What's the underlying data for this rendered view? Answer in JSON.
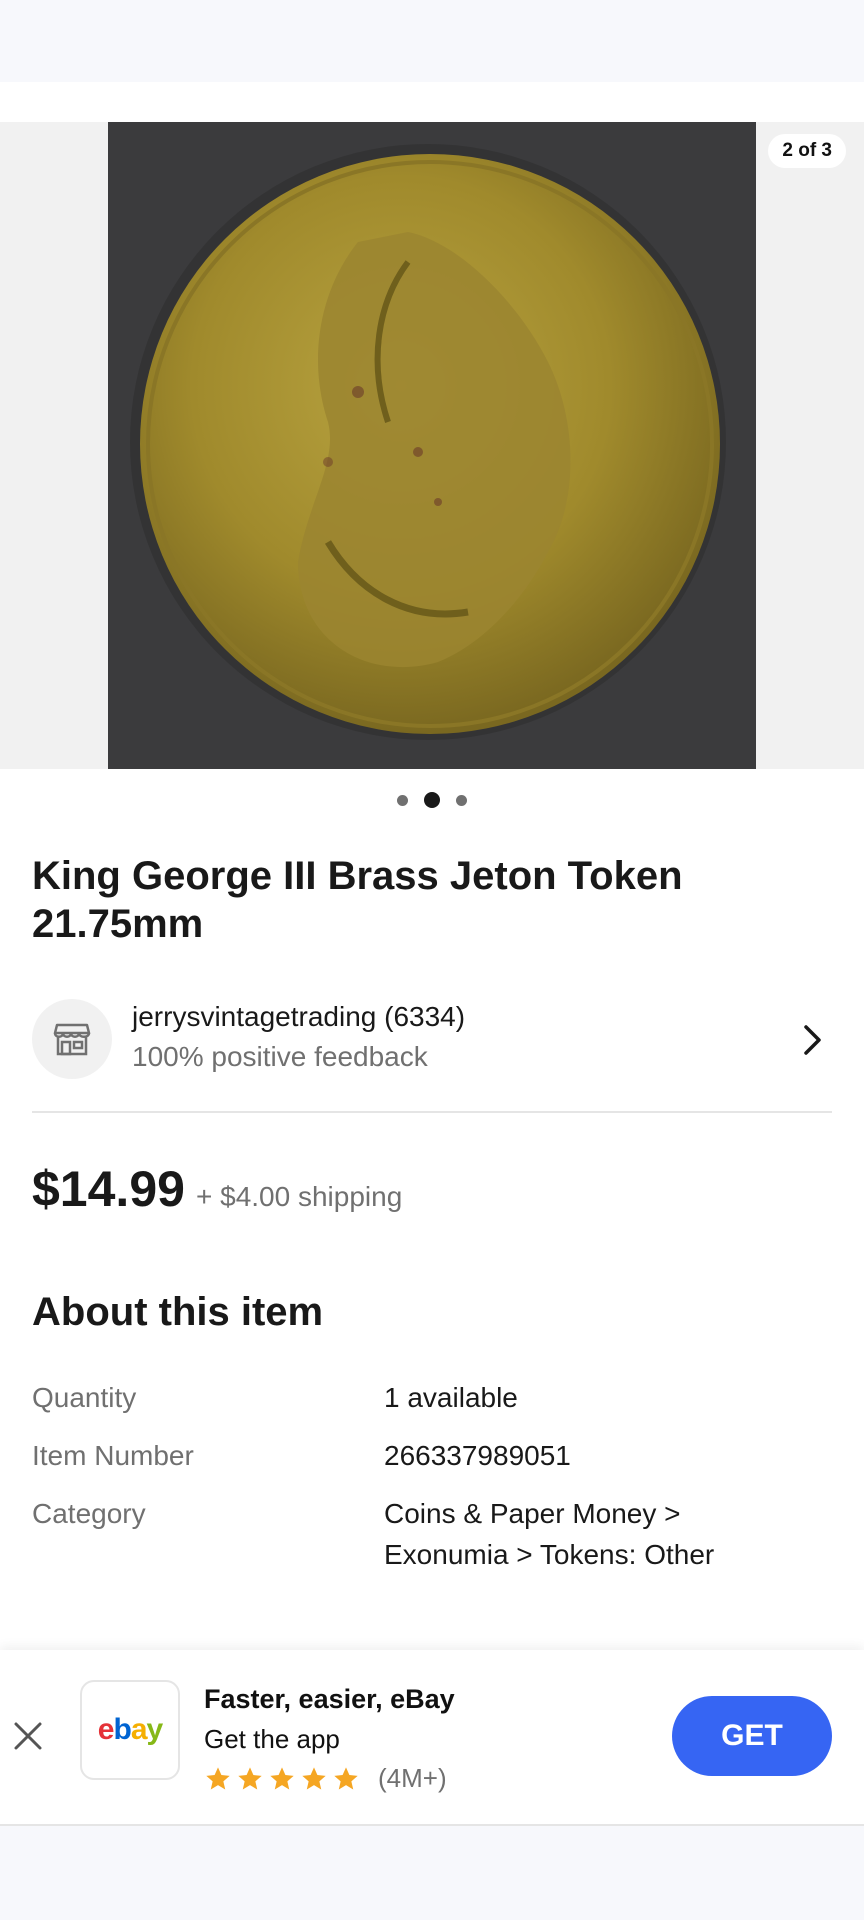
{
  "gallery": {
    "counter": "2 of 3",
    "dots": [
      {
        "active": false
      },
      {
        "active": true
      },
      {
        "active": false
      }
    ]
  },
  "listing": {
    "title": "King George III Brass Jeton Token 21.75mm",
    "seller": {
      "name": "jerrysvintagetrading (6334)",
      "feedback": "100% positive feedback",
      "icon": "store-icon"
    },
    "price": "$14.99",
    "shipping": "+ $4.00 shipping"
  },
  "about": {
    "heading": "About this item",
    "specs": [
      {
        "label": "Quantity",
        "value": "1 available"
      },
      {
        "label": "Item Number",
        "value": "266337989051"
      },
      {
        "label": "Category",
        "value": "Coins & Paper Money > Exonumia > Tokens: Other"
      }
    ]
  },
  "app_banner": {
    "title": "Faster, easier, eBay",
    "subtitle": "Get the app",
    "rating_stars": 5,
    "rating_count": "(4M+)",
    "get_label": "GET",
    "logo_letters": [
      {
        "ch": "e",
        "color": "#e53238"
      },
      {
        "ch": "b",
        "color": "#0064d2"
      },
      {
        "ch": "a",
        "color": "#f5af02"
      },
      {
        "ch": "y",
        "color": "#86b817"
      }
    ]
  },
  "colors": {
    "accent": "#3665f3",
    "star": "#f5a623"
  }
}
